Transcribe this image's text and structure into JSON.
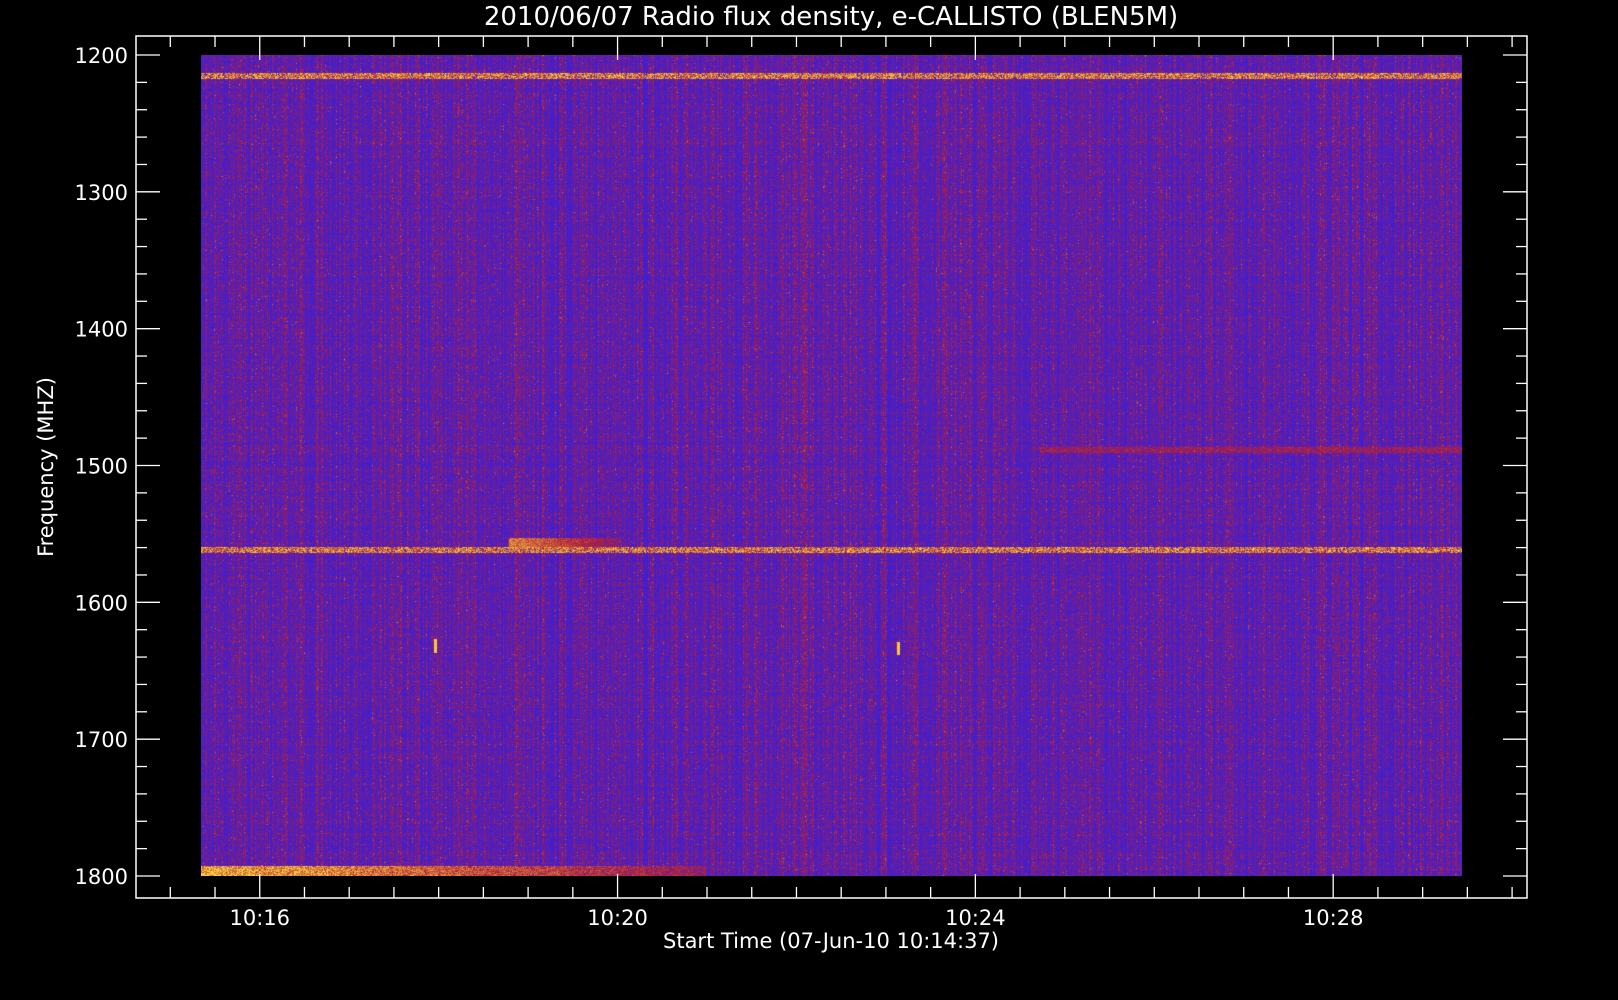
{
  "chart_data": {
    "type": "heatmap",
    "title": "2010/06/07  Radio flux density, e-CALLISTO (BLEN5M)",
    "xlabel": "Start Time (07-Jun-10 10:14:37)",
    "ylabel": "Frequency (MHZ)",
    "x_unit": "time (UT, hh:mm)",
    "xlim": [
      "10:14:37",
      "10:30:10"
    ],
    "data_xlim": [
      "10:15:00",
      "10:30:00"
    ],
    "x_ticks": [
      "10:16",
      "10:20",
      "10:24",
      "10:28"
    ],
    "ylim": [
      1200,
      1800
    ],
    "y_inverted": true,
    "y_ticks": [
      1200,
      1300,
      1400,
      1500,
      1600,
      1700,
      1800
    ],
    "colormap": "blue-red-yellow",
    "colors": {
      "background": "#000000",
      "low": "#1e1eff",
      "mid": "#b01e3c",
      "high": "#ffdc3c"
    },
    "grid": false,
    "features": [
      {
        "kind": "horizontal_band",
        "freq_mhz": 1215,
        "intensity": "high"
      },
      {
        "kind": "horizontal_band",
        "freq_mhz": 1562,
        "intensity": "high"
      },
      {
        "kind": "horizontal_band",
        "freq_mhz": 1489,
        "x_start": "10:25:00",
        "x_end": "10:30:00",
        "intensity": "medium"
      },
      {
        "kind": "emission_patch",
        "freq_range_mhz": [
          1793,
          1800
        ],
        "x_start": "10:15:00",
        "x_end": "10:21:00",
        "intensity": "high"
      },
      {
        "kind": "emission_patch",
        "freq_range_mhz": [
          1553,
          1560
        ],
        "x_start": "10:18:40",
        "x_end": "10:20:00",
        "intensity": "medium"
      },
      {
        "kind": "spike",
        "freq_mhz": 1632,
        "x": "10:17:47",
        "intensity": "high"
      },
      {
        "kind": "spike",
        "freq_mhz": 1634,
        "x": "10:23:18",
        "intensity": "high"
      }
    ]
  }
}
